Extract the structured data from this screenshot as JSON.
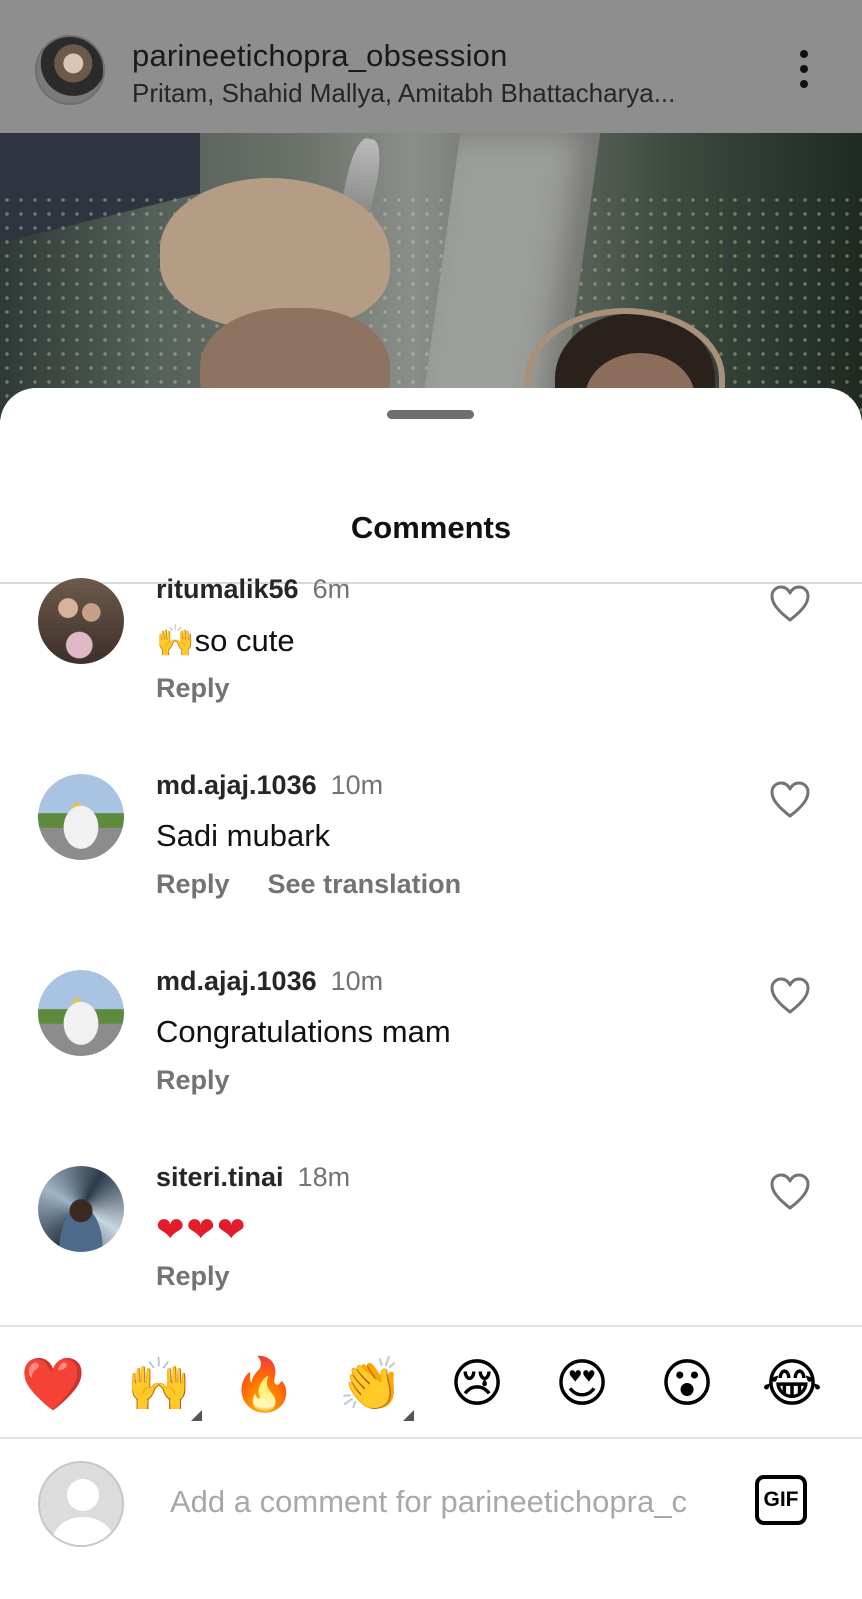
{
  "post_header": {
    "username": "parineetichopra_obsession",
    "audio_credits": "Pritam, Shahid Mallya, Amitabh Bhattacharya..."
  },
  "comments_sheet": {
    "title": "Comments",
    "comments": [
      {
        "username": "ritumalik56",
        "time": "6m",
        "emoji": "🙌",
        "text": "so cute",
        "reply_label": "Reply"
      },
      {
        "username": "md.ajaj.1036",
        "time": "10m",
        "text": "Sadi mubark",
        "reply_label": "Reply",
        "translate_label": "See translation"
      },
      {
        "username": "md.ajaj.1036",
        "time": "10m",
        "text": "Congratulations mam",
        "reply_label": "Reply"
      },
      {
        "username": "siteri.tinai",
        "time": "18m",
        "text": "❤❤❤",
        "reply_label": "Reply"
      }
    ]
  },
  "reaction_bar": {
    "emojis": [
      "❤️",
      "🙌",
      "🔥",
      "👏",
      "😢",
      "😍",
      "😮",
      "😂"
    ]
  },
  "composer": {
    "placeholder": "Add a comment for parineetichopra_c",
    "gif_label": "GIF"
  },
  "colors": {
    "heart_red": "#e11d2a",
    "header_overlay": "#8e8e8e",
    "secondary_text": "#737373"
  }
}
